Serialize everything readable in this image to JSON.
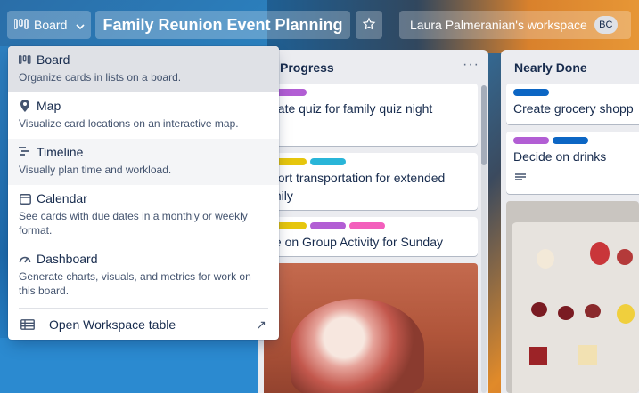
{
  "header": {
    "view_label": "Board",
    "board_title": "Family Reunion Event Planning",
    "workspace_label": "Laura Palmeranian's workspace",
    "avatar_initials": "BC"
  },
  "menu": {
    "items": [
      {
        "label": "Board",
        "icon": "board-icon",
        "description": "Organize cards in lists on a board."
      },
      {
        "label": "Map",
        "icon": "map-pin-icon",
        "description": "Visualize card locations on an interactive map."
      },
      {
        "label": "Timeline",
        "icon": "timeline-icon",
        "description": "Visually plan time and workload."
      },
      {
        "label": "Calendar",
        "icon": "calendar-icon",
        "description": "See cards with due dates in a monthly or weekly format."
      },
      {
        "label": "Dashboard",
        "icon": "dashboard-icon",
        "description": "Generate charts, visuals, and metrics for work on this board."
      }
    ],
    "footer_label": "Open Workspace table",
    "footer_icon": "table-icon",
    "footer_arrow": "↗"
  },
  "lists": {
    "in_progress": {
      "title": "Progress",
      "menu_glyph": "···",
      "cards": [
        {
          "text": "eate quiz for family quiz night",
          "labels": [
            "#b25ed4"
          ]
        },
        {
          "text": "port transportation for extended mily",
          "labels": [
            "#e6c60d",
            "#29b5d8"
          ]
        },
        {
          "text": "te on Group Activity for Sunday",
          "labels": [
            "#e6c60d",
            "#b25ed4",
            "#f35fbc"
          ]
        }
      ]
    },
    "nearly_done": {
      "title": "Nearly Done",
      "cards": [
        {
          "text": "Create grocery shopp",
          "labels": [
            "#0c66c4"
          ]
        },
        {
          "text": "Decide on drinks",
          "labels": [
            "#b25ed4",
            "#0c66c4"
          ]
        }
      ]
    }
  }
}
